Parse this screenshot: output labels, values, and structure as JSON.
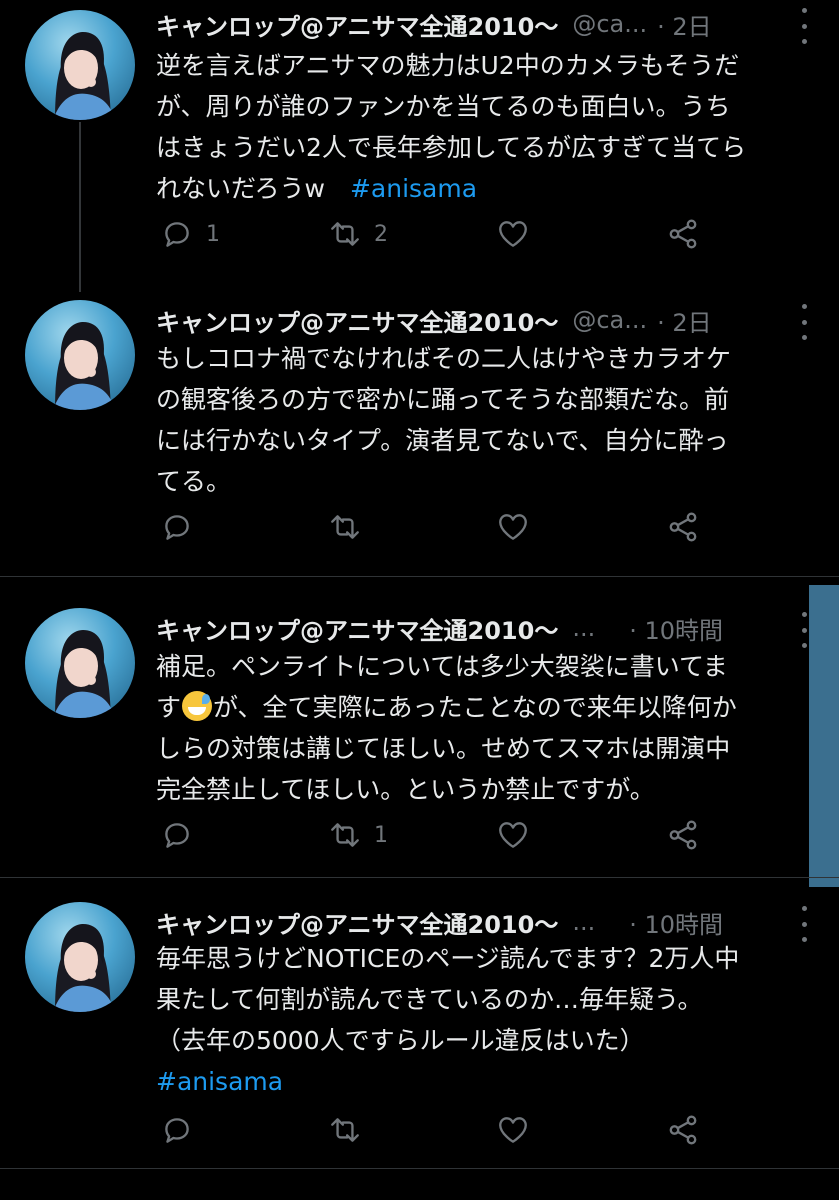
{
  "colors": {
    "background": "#000000",
    "text": "#e7e9ea",
    "muted": "#71767b",
    "hashtag": "#1d9bf0",
    "divider": "#2f3336",
    "scrollbar": "#3b6f8f"
  },
  "tweets": [
    {
      "name": "キャンロップ@アニサマ全通2010～",
      "handle": "@ca...",
      "time": "· 2日",
      "lines": [
        "逆を言えばアニサマの魅力はU2中のカメラもそうだ",
        "が、周りが誰のファンかを当てるのも面白い。うち",
        "はきょうだい2人で長年参加してるが広すぎて当てら"
      ],
      "last_line_text": "れないだろうw　",
      "hashtag": "#anisama",
      "reply_count": "1",
      "retweet_count": "2",
      "icons": [
        "reply-icon",
        "retweet-icon",
        "like-icon",
        "share-icon"
      ]
    },
    {
      "name": "キャンロップ@アニサマ全通2010～",
      "handle": "@ca...",
      "time": "· 2日",
      "lines": [
        "もしコロナ禍でなければその二人はけやきカラオケ",
        "の観客後ろの方で密かに踊ってそうな部類だな。前",
        "には行かないタイプ。演者見てないで、自分に酔っ",
        "てる。"
      ],
      "icons": [
        "reply-icon",
        "retweet-icon",
        "like-icon",
        "share-icon"
      ]
    },
    {
      "name": "キャンロップ@アニサマ全通2010～",
      "handle": "...",
      "time": "· 10時間",
      "lines": [
        "補足。ペンライトについては多少大袈裟に書いてま"
      ],
      "line2_before_emoji": "す",
      "emoji": "sweat-smile-emoji",
      "line2_after_emoji": "が、全て実際にあったことなので来年以降何か",
      "lines_after": [
        "しらの対策は講じてほしい。せめてスマホは開演中",
        "完全禁止してほしい。というか禁止ですが。"
      ],
      "retweet_count": "1",
      "icons": [
        "reply-icon",
        "retweet-icon",
        "like-icon",
        "share-icon"
      ]
    },
    {
      "name": "キャンロップ@アニサマ全通2010～",
      "handle": "...",
      "time": "· 10時間",
      "lines": [
        "毎年思うけどNOTICEのページ読んでます？2万人中",
        "果たして何割が読んできているのか…毎年疑う。",
        "（去年の5000人ですらルール違反はいた）"
      ],
      "hashtag": "#anisama",
      "icons": [
        "reply-icon",
        "retweet-icon",
        "like-icon",
        "share-icon"
      ]
    }
  ]
}
